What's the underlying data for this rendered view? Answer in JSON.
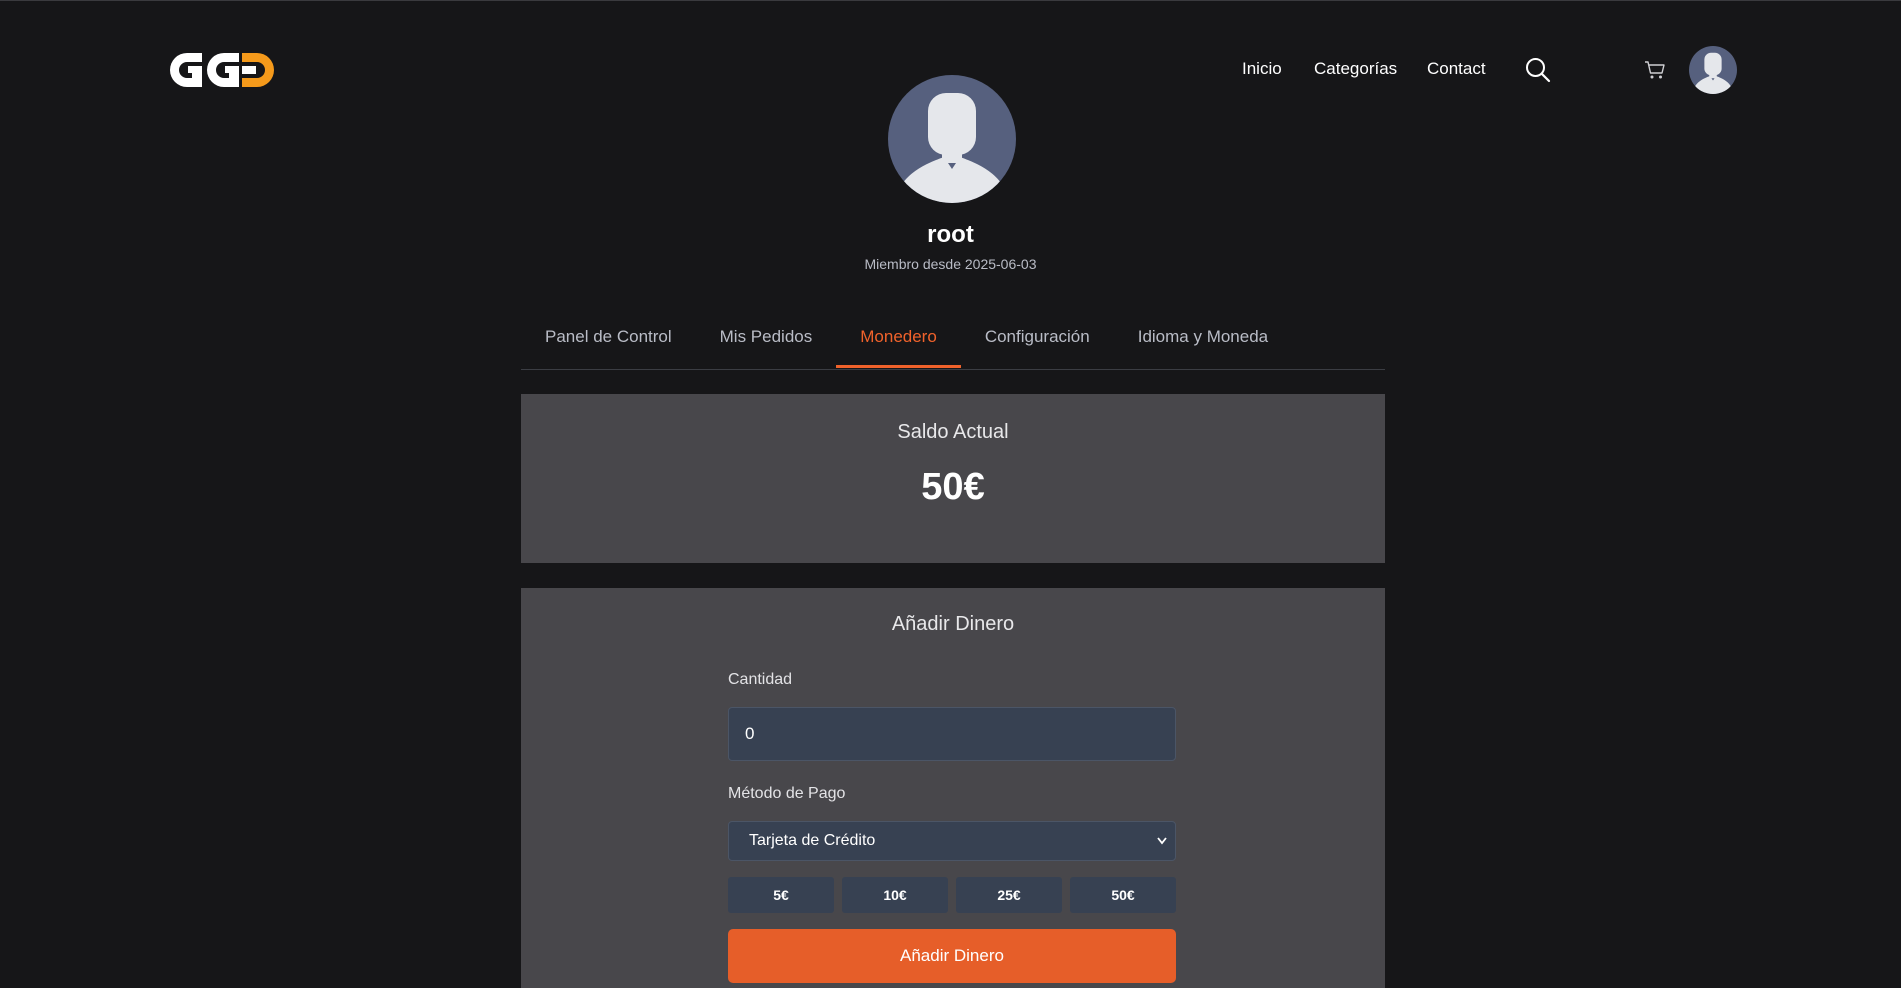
{
  "header": {
    "logo_text": "GGD",
    "nav": [
      "Inicio",
      "Categorías",
      "Contact"
    ],
    "search_icon": "search-icon",
    "cart_icon": "cart-icon",
    "avatar_icon": "user-avatar-icon"
  },
  "profile": {
    "username": "root",
    "member_since": "Miembro desde 2025-06-03"
  },
  "tabs": [
    {
      "label": "Panel de Control",
      "active": false
    },
    {
      "label": "Mis Pedidos",
      "active": false
    },
    {
      "label": "Monedero",
      "active": true
    },
    {
      "label": "Configuración",
      "active": false
    },
    {
      "label": "Idioma y Moneda",
      "active": false
    }
  ],
  "balance": {
    "title": "Saldo Actual",
    "value": "50€"
  },
  "add_money": {
    "title": "Añadir Dinero",
    "amount_label": "Cantidad",
    "amount_value": "0",
    "method_label": "Método de Pago",
    "method_selected": "Tarjeta de Crédito",
    "quick_amounts": [
      "5€",
      "10€",
      "25€",
      "50€"
    ],
    "submit_label": "Añadir Dinero"
  },
  "colors": {
    "background": "#161618",
    "card": "#48474b",
    "accent": "#f0622b",
    "input": "#374152",
    "logo_accent": "#f59a1b"
  }
}
